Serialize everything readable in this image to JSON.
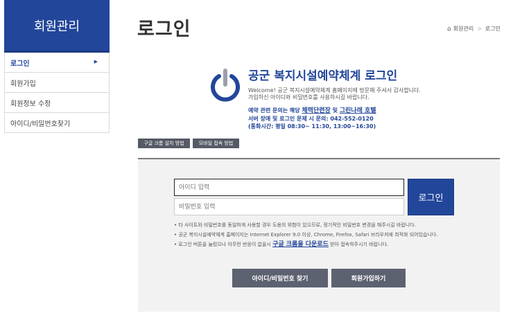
{
  "sidebar": {
    "title": "회원관리",
    "items": [
      {
        "label": "로그인"
      },
      {
        "label": "회원가입"
      },
      {
        "label": "회원정보 수정"
      },
      {
        "label": "아이디/비밀번호찾기"
      }
    ]
  },
  "page": {
    "title": "로그인",
    "breadcrumb": [
      "회원관리",
      "로그인"
    ]
  },
  "intro": {
    "title": "공군 복지시설예약체계 로그인",
    "line1": "Welcome! 공군 복지시설예약체계 홈페이지에 방문해 주셔서 감사합니다.",
    "line2": "가입하신 아이디와 비밀번호를 사용하시길 바랍니다.",
    "contact_prefix": "예약 관련 문의는 해당 ",
    "contact_link1": "체력단련장",
    "contact_mid": " 및 ",
    "contact_link2": "그린나래 호텔",
    "contact_line2": "서버 장애 및 로그인 문제 시 문의: 042-552-0120",
    "contact_line3": "(통화시간: 평일 08:30~ 11:30, 13:00~16:30)"
  },
  "guides": {
    "chrome_label": "구글 크롬 설치 방법",
    "mobile_label": "모바일 접속 방법"
  },
  "login": {
    "id_placeholder": "아이디 입력",
    "pw_placeholder": "비밀번호 입력",
    "button_label": "로그인",
    "note1": "• 타 사이트와 비밀번호를 동일하게 사용할 경우 도용의 위험이 있으므로, 정기적인 비밀번호 변경을 해주시길 바랍니다.",
    "note2": "• 공군 복지시설예약체계 홈페이지는 Internet Explorer 9.0 이상, Chrome, Firefox, Safari 브라우저에 최적화 되어있습니다.",
    "note3_prefix": "• 로그인 버튼을 눌렀으나 아무런 반응이 없을시 ",
    "note3_link": "구글 크롬을 다운로드",
    "note3_suffix": " 받아 접속하주시기 바랍니다.",
    "find_label": "아이디/비밀번호 찾기",
    "join_label": "회원가입하기"
  },
  "colors": {
    "brand": "#22469a",
    "dark_button": "#5d6270"
  },
  "icons": {
    "logo": "power-icon",
    "home": "home-icon",
    "caret": "caret-right-icon"
  }
}
